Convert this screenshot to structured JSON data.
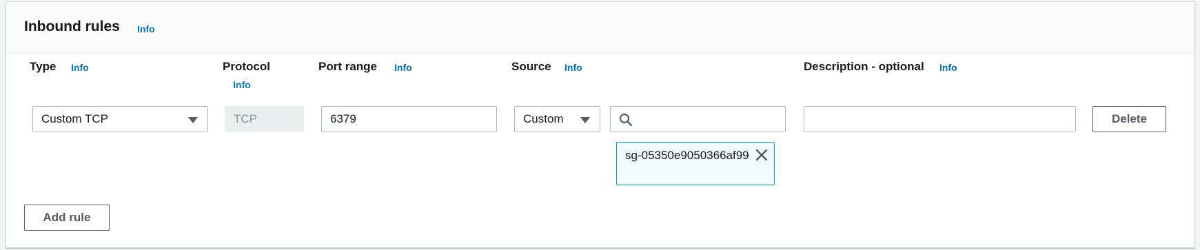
{
  "panel": {
    "title": "Inbound rules",
    "info": "Info"
  },
  "columns": {
    "type": {
      "label": "Type",
      "info": "Info"
    },
    "protocol": {
      "label": "Protocol",
      "info": "Info"
    },
    "port_range": {
      "label": "Port range",
      "info": "Info"
    },
    "source": {
      "label": "Source",
      "info": "Info"
    },
    "description": {
      "label": "Description - optional",
      "info": "Info"
    }
  },
  "rule": {
    "type_value": "Custom TCP",
    "protocol_value": "TCP",
    "port_range_value": "6379",
    "source_type_value": "Custom",
    "source_search_value": "",
    "source_token": "sg-05350e9050366af99",
    "description_value": "",
    "delete_label": "Delete"
  },
  "actions": {
    "add_rule_label": "Add rule"
  },
  "icons": {
    "search": "search-icon",
    "close": "close-icon",
    "caret": "caret-down-icon"
  },
  "colors": {
    "link": "#0073bb",
    "token_border": "#00a1c9",
    "token_bg": "#f1faff"
  }
}
